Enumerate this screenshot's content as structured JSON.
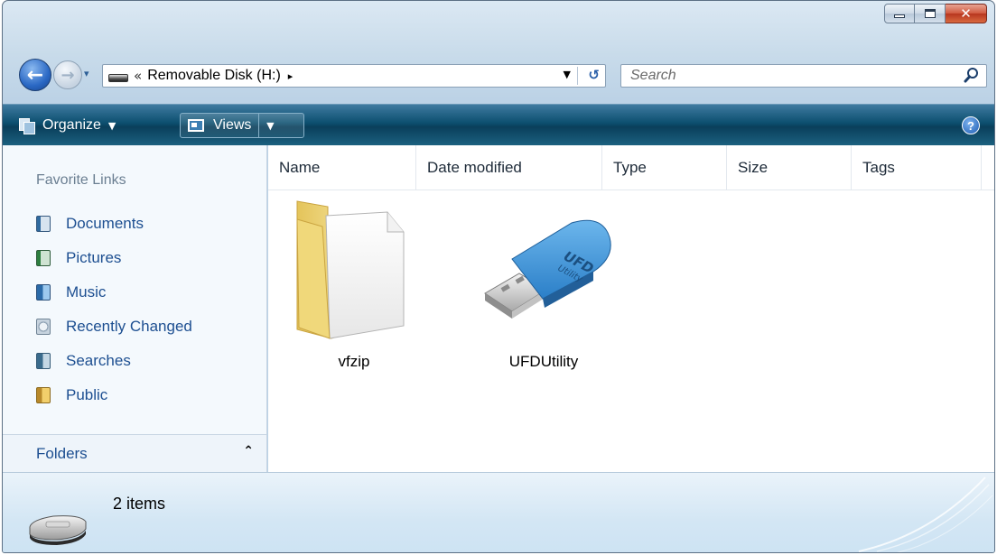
{
  "window": {
    "caption_buttons": {
      "minimize_icon": "minimize-icon",
      "maximize_icon": "maximize-icon",
      "close_glyph": "✕"
    }
  },
  "navigation": {
    "back_glyph": "←",
    "forward_glyph": "→",
    "history_glyph": "▾",
    "breadcrumb_overflow": "«",
    "breadcrumb_location": "Removable Disk (H:)",
    "breadcrumb_arrow": "▸",
    "address_dropdown_glyph": "▼",
    "refresh_glyph": "↺",
    "search_placeholder": "Search"
  },
  "command_bar": {
    "organize_label": "Organize",
    "organize_arrow": "▼",
    "views_label": "Views",
    "views_arrow": "▼",
    "help_glyph": "?"
  },
  "sidebar": {
    "favorites_title": "Favorite Links",
    "items": [
      {
        "label": "Documents",
        "icon": "documents-icon"
      },
      {
        "label": "Pictures",
        "icon": "pictures-icon"
      },
      {
        "label": "Music",
        "icon": "music-icon"
      },
      {
        "label": "Recently Changed",
        "icon": "recently-changed-icon"
      },
      {
        "label": "Searches",
        "icon": "searches-icon"
      },
      {
        "label": "Public",
        "icon": "public-icon"
      }
    ],
    "folders_label": "Folders",
    "folders_chevron": "⌃"
  },
  "file_list": {
    "columns": [
      "Name",
      "Date modified",
      "Type",
      "Size",
      "Tags"
    ],
    "items": [
      {
        "name": "vfzip",
        "icon": "folder-icon"
      },
      {
        "name": "UFDUtility",
        "icon": "usb-drive-icon",
        "icon_text": "UFD",
        "icon_subtext": "Utility"
      }
    ]
  },
  "details_pane": {
    "item_count": "2 items",
    "icon": "removable-disk-icon"
  }
}
